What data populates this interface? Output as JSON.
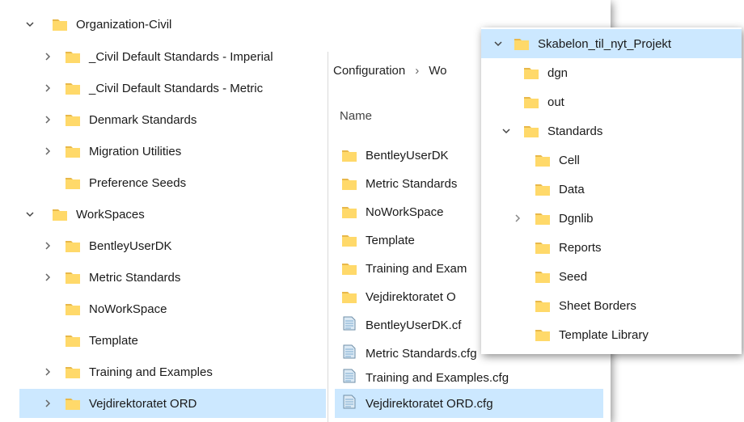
{
  "left_tree": {
    "items": [
      {
        "label": "Organization-Civil",
        "expanded": true,
        "chevron": "down"
      },
      {
        "label": "_Civil Default Standards - Imperial",
        "chevron": "right"
      },
      {
        "label": "_Civil Default Standards - Metric",
        "chevron": "right"
      },
      {
        "label": "Denmark Standards",
        "chevron": "right"
      },
      {
        "label": "Migration Utilities",
        "chevron": "right"
      },
      {
        "label": "Preference Seeds",
        "chevron": "none"
      },
      {
        "label": "WorkSpaces",
        "expanded": true,
        "chevron": "down"
      },
      {
        "label": "BentleyUserDK",
        "chevron": "right"
      },
      {
        "label": "Metric Standards",
        "chevron": "right"
      },
      {
        "label": "NoWorkSpace",
        "chevron": "none"
      },
      {
        "label": "Template",
        "chevron": "none"
      },
      {
        "label": "Training and Examples",
        "chevron": "right"
      },
      {
        "label": "Vejdirektoratet ORD",
        "chevron": "right",
        "selected": true
      }
    ]
  },
  "middle": {
    "breadcrumb": [
      "Configuration",
      "Wo"
    ],
    "breadcrumb_sep": "›",
    "column_header": "Name",
    "items": [
      {
        "label": "BentleyUserDK",
        "type": "folder"
      },
      {
        "label": "Metric Standards",
        "type": "folder"
      },
      {
        "label": "NoWorkSpace",
        "type": "folder"
      },
      {
        "label": "Template",
        "type": "folder"
      },
      {
        "label": "Training and Exam",
        "type": "folder"
      },
      {
        "label": "Vejdirektoratet O",
        "type": "folder"
      },
      {
        "label": "BentleyUserDK.cf",
        "type": "cfg"
      },
      {
        "label": "Metric Standards.cfg",
        "type": "cfg"
      },
      {
        "label": "Training and Examples.cfg",
        "type": "cfg"
      },
      {
        "label": "Vejdirektoratet ORD.cfg",
        "type": "cfg",
        "selected": true
      }
    ]
  },
  "right_tree": {
    "items": [
      {
        "label": "Skabelon_til_nyt_Projekt",
        "chevron": "down",
        "selected": true
      },
      {
        "label": "dgn",
        "chevron": "none"
      },
      {
        "label": "out",
        "chevron": "none"
      },
      {
        "label": "Standards",
        "chevron": "down"
      },
      {
        "label": "Cell",
        "chevron": "none"
      },
      {
        "label": "Data",
        "chevron": "none"
      },
      {
        "label": "Dgnlib",
        "chevron": "right"
      },
      {
        "label": "Reports",
        "chevron": "none"
      },
      {
        "label": "Seed",
        "chevron": "none"
      },
      {
        "label": "Sheet Borders",
        "chevron": "none"
      },
      {
        "label": "Template Library",
        "chevron": "none"
      }
    ]
  },
  "colors": {
    "selection": "#cce8ff",
    "folder_body": "#ffd96a",
    "folder_tab": "#e8b84a",
    "cfg_blue": "#8fb8d8"
  },
  "icons": {
    "folder": "folder-icon",
    "cfg_file": "config-file-icon",
    "expand": "chevron-right-icon",
    "collapse": "chevron-down-icon"
  }
}
